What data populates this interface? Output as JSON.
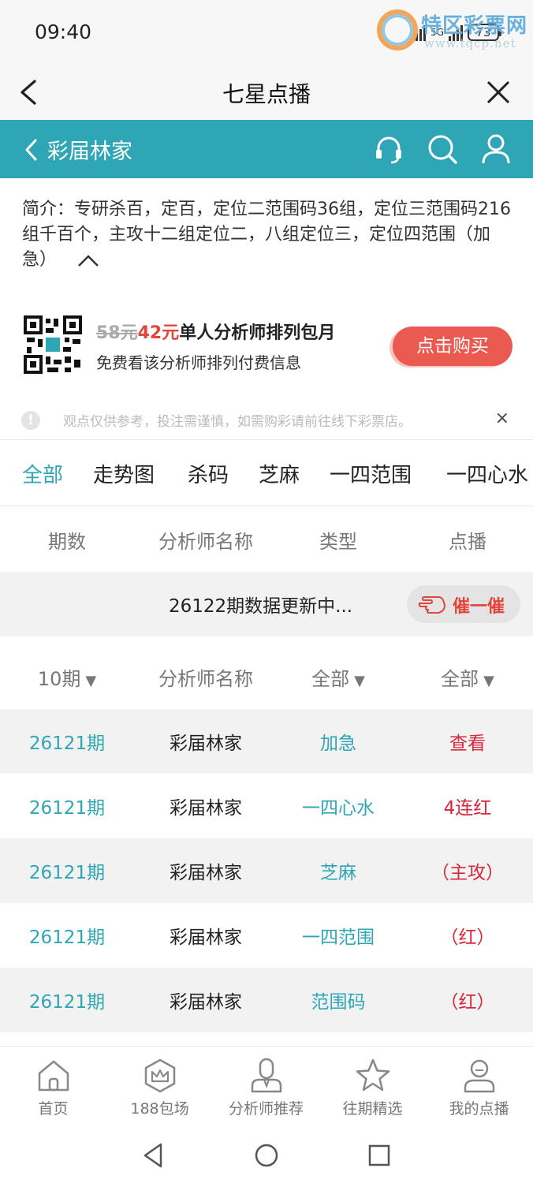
{
  "status_bar": {
    "time": "09:40",
    "network": "5G",
    "battery": "73"
  },
  "watermark": {
    "title": "特区彩票网",
    "url": "www.tqcp.net"
  },
  "top_bar": {
    "title": "七星点播"
  },
  "header": {
    "title": "彩届林家"
  },
  "intro": {
    "text": "简介：专研杀百，定百，定位二范围码36组，定位三范围码216组千百个，主攻十二组定位二，八组定位三，定位四范围（加急）"
  },
  "promo": {
    "old_price": "58元",
    "new_price": "42元",
    "title": "单人分析师排列包月",
    "subtitle": "免费看该分析师排列付费信息",
    "buy_label": "点击购买"
  },
  "notice": {
    "icon_text": "!",
    "text": "观点仅供参考，投注需谨慎，如需购彩请前往线下彩票店。",
    "close": "×"
  },
  "tabs": [
    "全部",
    "走势图",
    "杀码",
    "芝麻",
    "一四范围",
    "一四心水"
  ],
  "table": {
    "headers": [
      "期数",
      "分析师名称",
      "类型",
      "点播"
    ],
    "update_text": "26122期数据更新中...",
    "urge_label": "催一催",
    "filters": {
      "period": "10期",
      "analyst": "分析师名称",
      "type": "全部",
      "play": "全部",
      "caret": "▼"
    },
    "rows": [
      {
        "period": "26121期",
        "analyst": "彩届林家",
        "type": "加急",
        "result": "查看"
      },
      {
        "period": "26121期",
        "analyst": "彩届林家",
        "type": "一四心水",
        "result": "4连红"
      },
      {
        "period": "26121期",
        "analyst": "彩届林家",
        "type": "芝麻",
        "result": "（主攻）"
      },
      {
        "period": "26121期",
        "analyst": "彩届林家",
        "type": "一四范围",
        "result": "（红）"
      },
      {
        "period": "26121期",
        "analyst": "彩届林家",
        "type": "范围码",
        "result": "（红）"
      }
    ]
  },
  "bottom_nav": [
    {
      "label": "首页",
      "icon": "home-icon"
    },
    {
      "label": "188包场",
      "icon": "crown-icon"
    },
    {
      "label": "分析师推荐",
      "icon": "analyst-icon"
    },
    {
      "label": "往期精选",
      "icon": "star-icon"
    },
    {
      "label": "我的点播",
      "icon": "user-icon"
    }
  ],
  "colors": {
    "accent": "#2fa6b6",
    "danger": "#d8263b",
    "buy_button": "#ea5a50"
  }
}
